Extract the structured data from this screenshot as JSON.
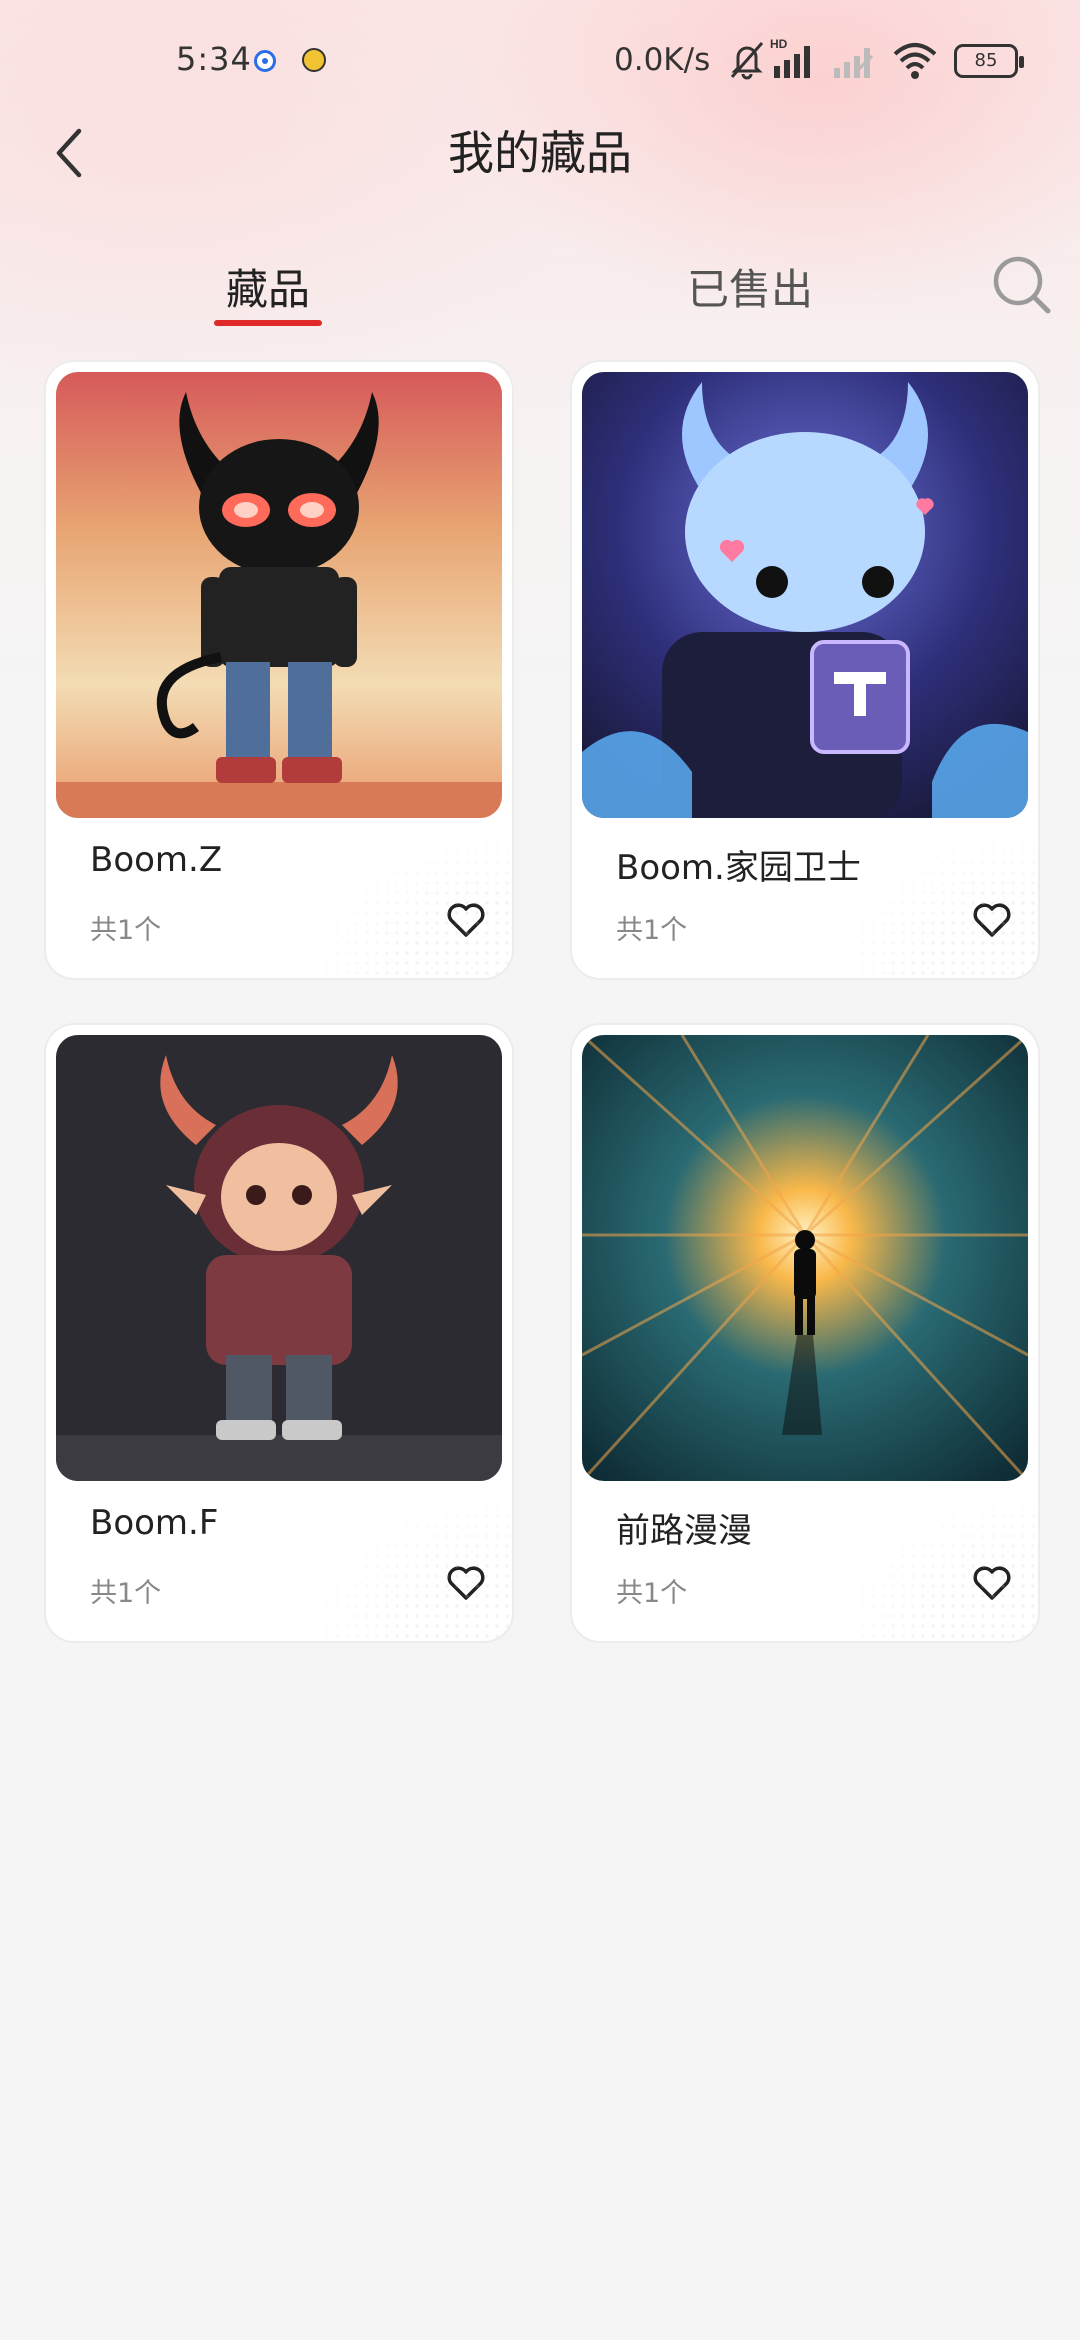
{
  "status_bar": {
    "time": "5:34",
    "network_speed": "0.0K/s",
    "battery": "85",
    "icons": [
      "location-app-icon",
      "yellow-app-icon",
      "mute-bell-icon",
      "hd-signal-icon",
      "signal-weak-icon",
      "wifi-icon",
      "battery-icon"
    ]
  },
  "header": {
    "title": "我的藏品",
    "back_icon": "chevron-left-icon"
  },
  "tabs": {
    "collection": "藏品",
    "sold": "已售出",
    "active": "collection",
    "search_icon": "search-icon",
    "accent_color": "#e02a2a"
  },
  "items": [
    {
      "title": "Boom.Z",
      "count": "共1个",
      "image": "pixel-devil-black-hoodie",
      "icon": "heart-outline-icon"
    },
    {
      "title": "Boom.家园卫士",
      "count": "共1个",
      "image": "pixel-blue-monster-cube",
      "icon": "heart-outline-icon"
    },
    {
      "title": "Boom.F",
      "count": "共1个",
      "image": "pixel-devil-red-hoodie",
      "icon": "heart-outline-icon"
    },
    {
      "title": "前路漫漫",
      "count": "共1个",
      "image": "light-tunnel-silhouette",
      "icon": "heart-outline-icon"
    }
  ]
}
